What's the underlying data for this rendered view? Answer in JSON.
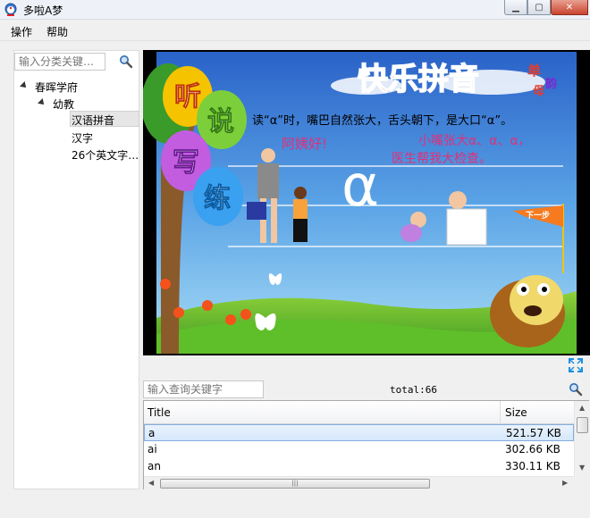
{
  "window": {
    "title": "多啦A梦"
  },
  "menu": {
    "items": [
      {
        "label": "操作"
      },
      {
        "label": "帮助"
      }
    ]
  },
  "category_search": {
    "placeholder": "输入分类关键…"
  },
  "tree": {
    "root": "春晖学府",
    "child": "幼教",
    "leaves": [
      "汉语拼音",
      "汉字",
      "26个英文字…"
    ]
  },
  "player": {
    "balloons": [
      "听",
      "说",
      "写",
      "练"
    ],
    "title": "快乐拼音",
    "subtitle_chars": [
      "单",
      "韵",
      "母"
    ],
    "instruction": "读“α”时，嘴巴自然张大，舌头朝下，是大口“α”。",
    "greeting": "阿姨好!",
    "rhyme_line1": "小嘴张大α、α、α，",
    "rhyme_line2": "医生帮我大检查。",
    "big_letter": "α",
    "next_button": "下一步"
  },
  "query_search": {
    "placeholder": "输入查询关键字"
  },
  "total": {
    "label": "total:66"
  },
  "table": {
    "headers": {
      "title": "Title",
      "size": "Size"
    },
    "rows": [
      {
        "title": "a",
        "size": "521.57 KB"
      },
      {
        "title": "ai",
        "size": "302.66 KB"
      },
      {
        "title": "an",
        "size": "330.11 KB"
      }
    ]
  },
  "colors": {
    "sky_top": "#2a62c8",
    "sky_bottom": "#8fd2f5",
    "grass": "#4aa82a",
    "selection": "#d4e7fb",
    "title_accent": "#e63d2b"
  }
}
